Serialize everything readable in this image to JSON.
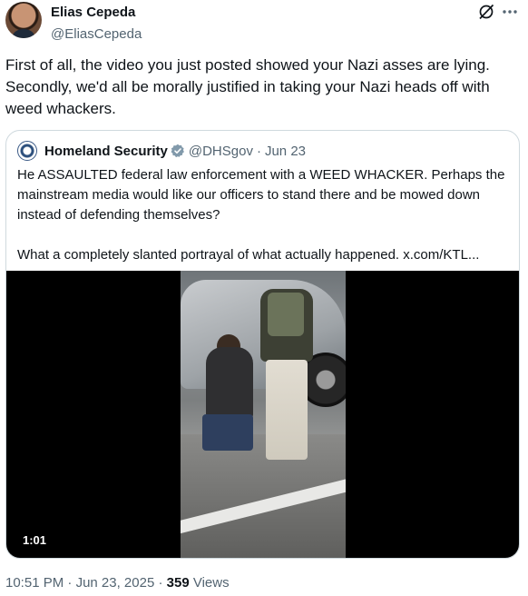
{
  "author": {
    "name": "Elias Cepeda",
    "handle": "@EliasCepeda",
    "avatar_icon": "profile-photo"
  },
  "header_icons": [
    "grok-icon",
    "more-icon"
  ],
  "tweet": {
    "text": "First of all, the video you just posted showed your Nazi asses are lying. Secondly, we'd all be morally justified in taking your Nazi heads off with weed whackers."
  },
  "quote": {
    "name": "Homeland Security",
    "handle": "@DHSgov",
    "separator": "·",
    "date": "Jun 23",
    "verified_color": "#829aab",
    "paragraph1": "He ASSAULTED federal law enforcement with a WEED WHACKER. Perhaps the mainstream media would like our officers to stand there and be mowed down instead of defending themselves?",
    "paragraph2": "What a completely slanted portrayal of what actually happened.  x.com/KTL...",
    "video": {
      "duration": "1:01"
    }
  },
  "footer": {
    "time": "10:51 PM",
    "separator": "·",
    "date": "Jun 23, 2025",
    "separator2": "·",
    "views_count": "359",
    "views_label": "Views"
  },
  "colors": {
    "text": "#0f1419",
    "secondary": "#536471",
    "border": "#cfd9de"
  }
}
